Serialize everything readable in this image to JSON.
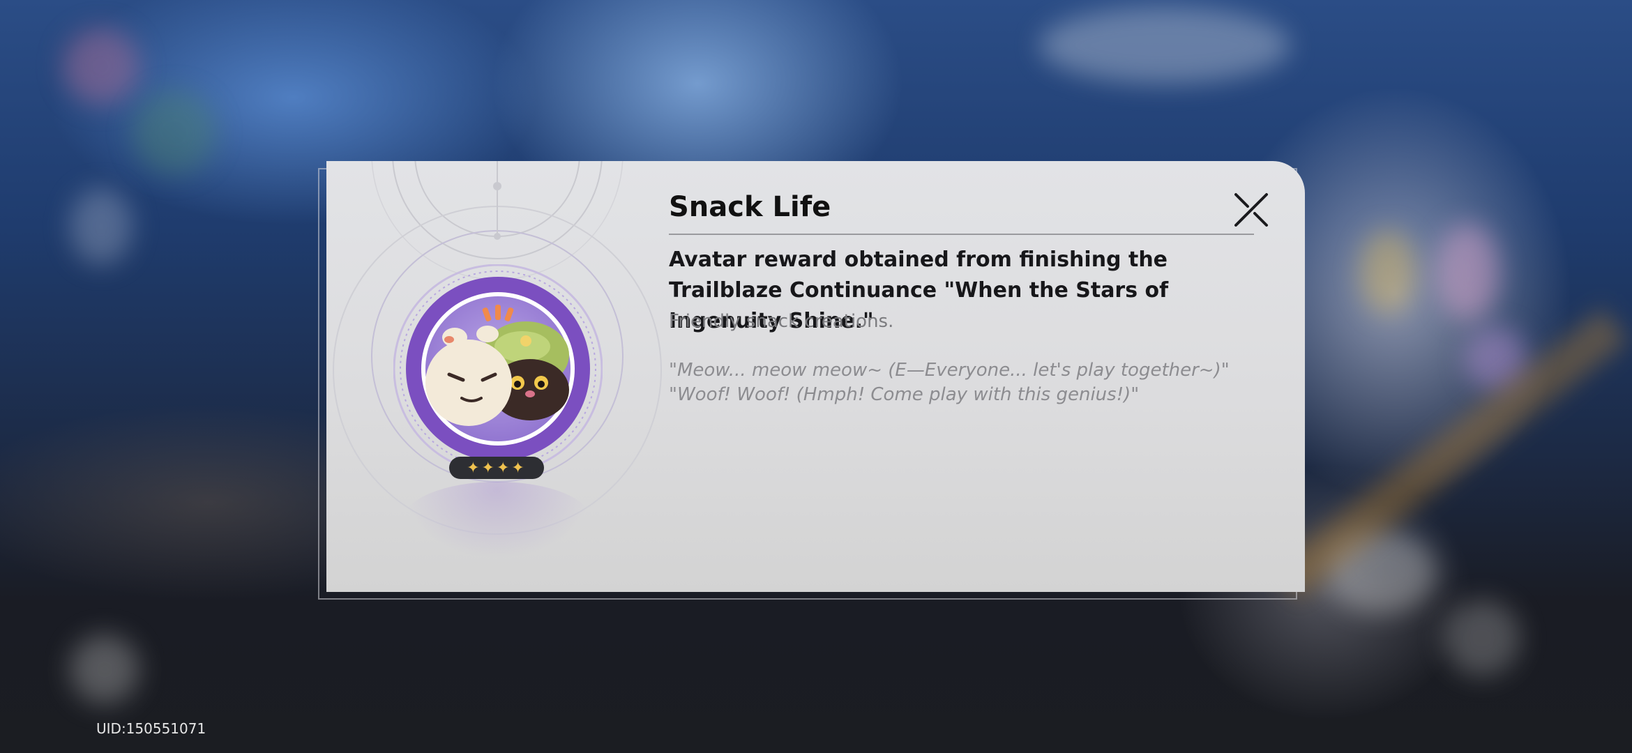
{
  "dialog": {
    "title": "Snack Life",
    "description": "Avatar reward obtained from finishing the Trailblaze Continuance \"When the Stars of Ingenuity Shine.\"",
    "subtitle": "Friendly snack creations.",
    "quotes": [
      "\"Meow... meow meow~ (E—Everyone... let's play together~)\"",
      "\"Woof! Woof! (Hmph! Come play with this genius!)\""
    ],
    "rarity_stars": "✦✦✦✦",
    "rarity": 4,
    "close_icon": "close-x-icon",
    "avatar_icon": "snack-life-avatar-icon"
  },
  "footer": {
    "uid": "UID:150551071"
  },
  "colors": {
    "medal_purple": "#7b4fc0",
    "star_gold": "#f0c24f",
    "pill_dark": "#2d2e33"
  }
}
